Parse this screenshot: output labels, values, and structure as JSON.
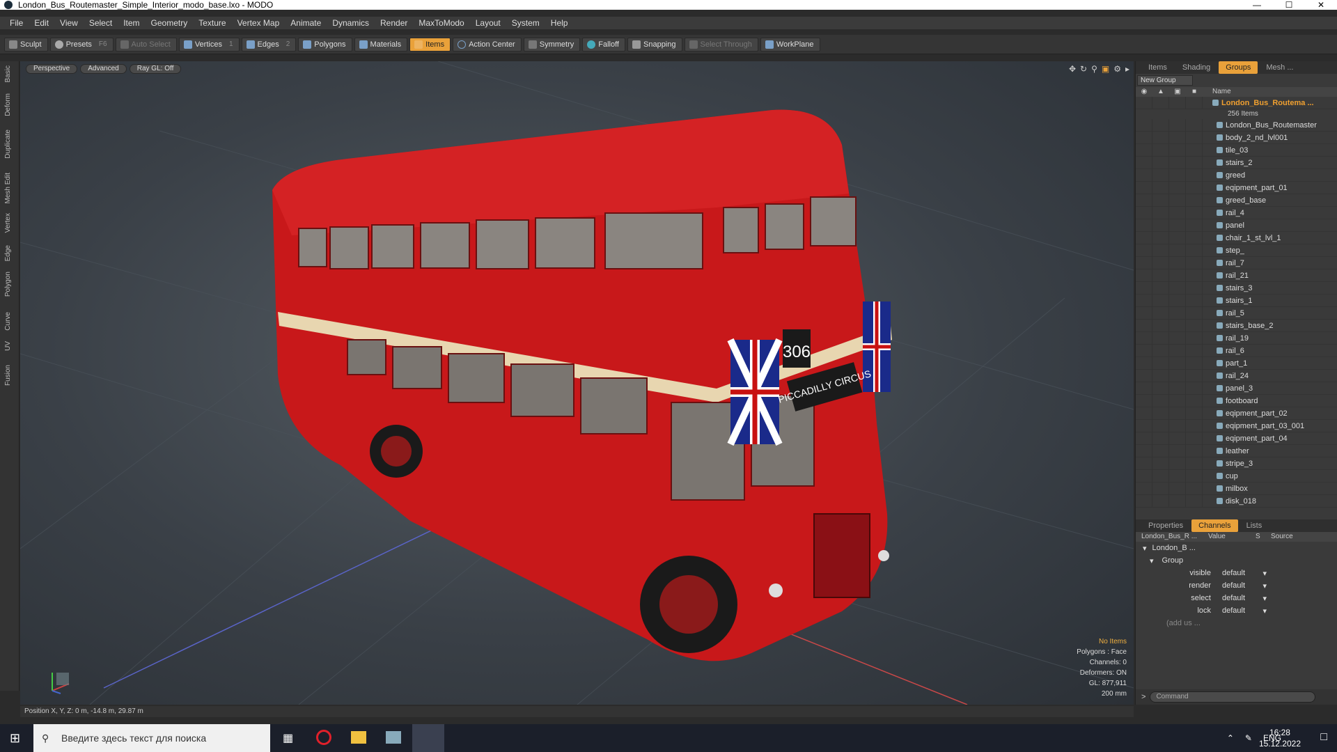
{
  "window": {
    "title": "London_Bus_Routemaster_Simple_Interior_modo_base.lxo - MODO"
  },
  "menu": [
    "File",
    "Edit",
    "View",
    "Select",
    "Item",
    "Geometry",
    "Texture",
    "Vertex Map",
    "Animate",
    "Dynamics",
    "Render",
    "MaxToModo",
    "Layout",
    "System",
    "Help"
  ],
  "toolbar": {
    "sculpt": "Sculpt",
    "presets": "Presets",
    "presets_key": "F6",
    "auto_select": "Auto Select",
    "vertices": "Vertices",
    "vertices_key": "1",
    "edges": "Edges",
    "edges_key": "2",
    "polygons": "Polygons",
    "materials": "Materials",
    "items": "Items",
    "action_center": "Action Center",
    "symmetry": "Symmetry",
    "falloff": "Falloff",
    "snapping": "Snapping",
    "select_through": "Select Through",
    "workplane": "WorkPlane"
  },
  "left_tabs": [
    "Basic",
    "Deform",
    "Duplicate",
    "Mesh Edit",
    "Vertex",
    "Edge",
    "Polygon",
    "Curve",
    "UV",
    "Fusion"
  ],
  "viewport": {
    "perspective": "Perspective",
    "advanced": "Advanced",
    "raygl": "Ray GL: Off",
    "info": {
      "no_items": "No Items",
      "polygons": "Polygons : Face",
      "channels": "Channels: 0",
      "deformers": "Deformers: ON",
      "gl": "GL: 877,911",
      "scale": "200 mm"
    },
    "bus_route_number": "306",
    "bus_destination": "PICCADILLY CIRCUS"
  },
  "status": {
    "position": "Position X, Y, Z:  0 m, -14.8 m, 29.87 m"
  },
  "panel_top": {
    "tabs": [
      "Items",
      "Shading",
      "Groups",
      "Mesh ..."
    ],
    "active_tab": "Groups",
    "new_group": "New Group",
    "name_header": "Name",
    "group_name": "London_Bus_Routema ...",
    "group_count": "256 Items",
    "items": [
      "London_Bus_Routemaster",
      "body_2_nd_lvl001",
      "tile_03",
      "stairs_2",
      "greed",
      "eqipment_part_01",
      "greed_base",
      "rail_4",
      "panel",
      "chair_1_st_lvl_1",
      "step_",
      "rail_7",
      "rail_21",
      "stairs_3",
      "stairs_1",
      "rail_5",
      "stairs_base_2",
      "rail_19",
      "rail_6",
      "part_1",
      "rail_24",
      "panel_3",
      "footboard",
      "eqipment_part_02",
      "eqipment_part_03_001",
      "eqipment_part_04",
      "leather",
      "stripe_3",
      "cup",
      "milbox",
      "disk_018"
    ]
  },
  "panel_bottom": {
    "tabs": [
      "Properties",
      "Channels",
      "Lists"
    ],
    "active_tab": "Channels",
    "headers": {
      "name": "London_Bus_R ...",
      "value": "Value",
      "s": "S",
      "source": "Source"
    },
    "root": "London_B ...",
    "group": "Group",
    "rows": [
      {
        "name": "visible",
        "value": "default"
      },
      {
        "name": "render",
        "value": "default"
      },
      {
        "name": "select",
        "value": "default"
      },
      {
        "name": "lock",
        "value": "default"
      }
    ],
    "add_user": "(add us ...",
    "command_placeholder": "Command"
  },
  "taskbar": {
    "search": "Введите здесь текст для поиска",
    "lang": "ENG",
    "time": "16:28",
    "date": "15.12.2022"
  }
}
